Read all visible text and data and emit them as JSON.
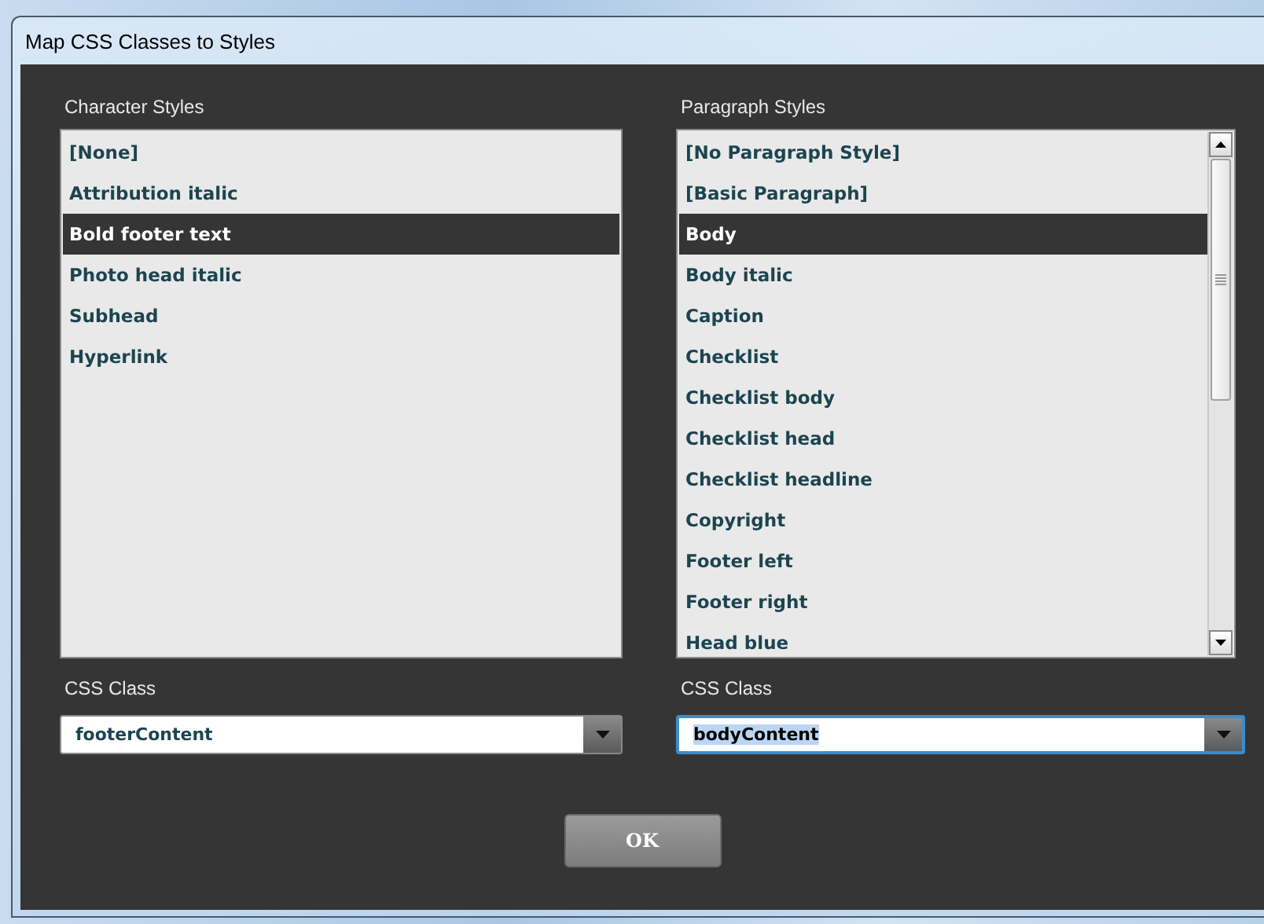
{
  "window": {
    "title": "Map CSS Classes to Styles"
  },
  "character_styles": {
    "label": "Character Styles",
    "items": [
      {
        "label": "[None]",
        "selected": false
      },
      {
        "label": "Attribution italic",
        "selected": false
      },
      {
        "label": "Bold footer text",
        "selected": true
      },
      {
        "label": "Photo head italic",
        "selected": false
      },
      {
        "label": "Subhead",
        "selected": false
      },
      {
        "label": "Hyperlink",
        "selected": false
      }
    ]
  },
  "paragraph_styles": {
    "label": "Paragraph Styles",
    "items": [
      {
        "label": "[No Paragraph Style]",
        "selected": false
      },
      {
        "label": "[Basic Paragraph]",
        "selected": false
      },
      {
        "label": "Body",
        "selected": true
      },
      {
        "label": "Body italic",
        "selected": false
      },
      {
        "label": "Caption",
        "selected": false
      },
      {
        "label": "Checklist",
        "selected": false
      },
      {
        "label": "Checklist body",
        "selected": false
      },
      {
        "label": "Checklist head",
        "selected": false
      },
      {
        "label": "Checklist headline",
        "selected": false
      },
      {
        "label": "Copyright",
        "selected": false
      },
      {
        "label": "Footer left",
        "selected": false
      },
      {
        "label": "Footer right",
        "selected": false
      },
      {
        "label": "Head blue",
        "selected": false
      }
    ]
  },
  "character_css_class": {
    "label": "CSS Class",
    "value": "footerContent",
    "focused": false
  },
  "paragraph_css_class": {
    "label": "CSS Class",
    "value": "bodyContent",
    "focused": true
  },
  "buttons": [
    "OK"
  ]
}
